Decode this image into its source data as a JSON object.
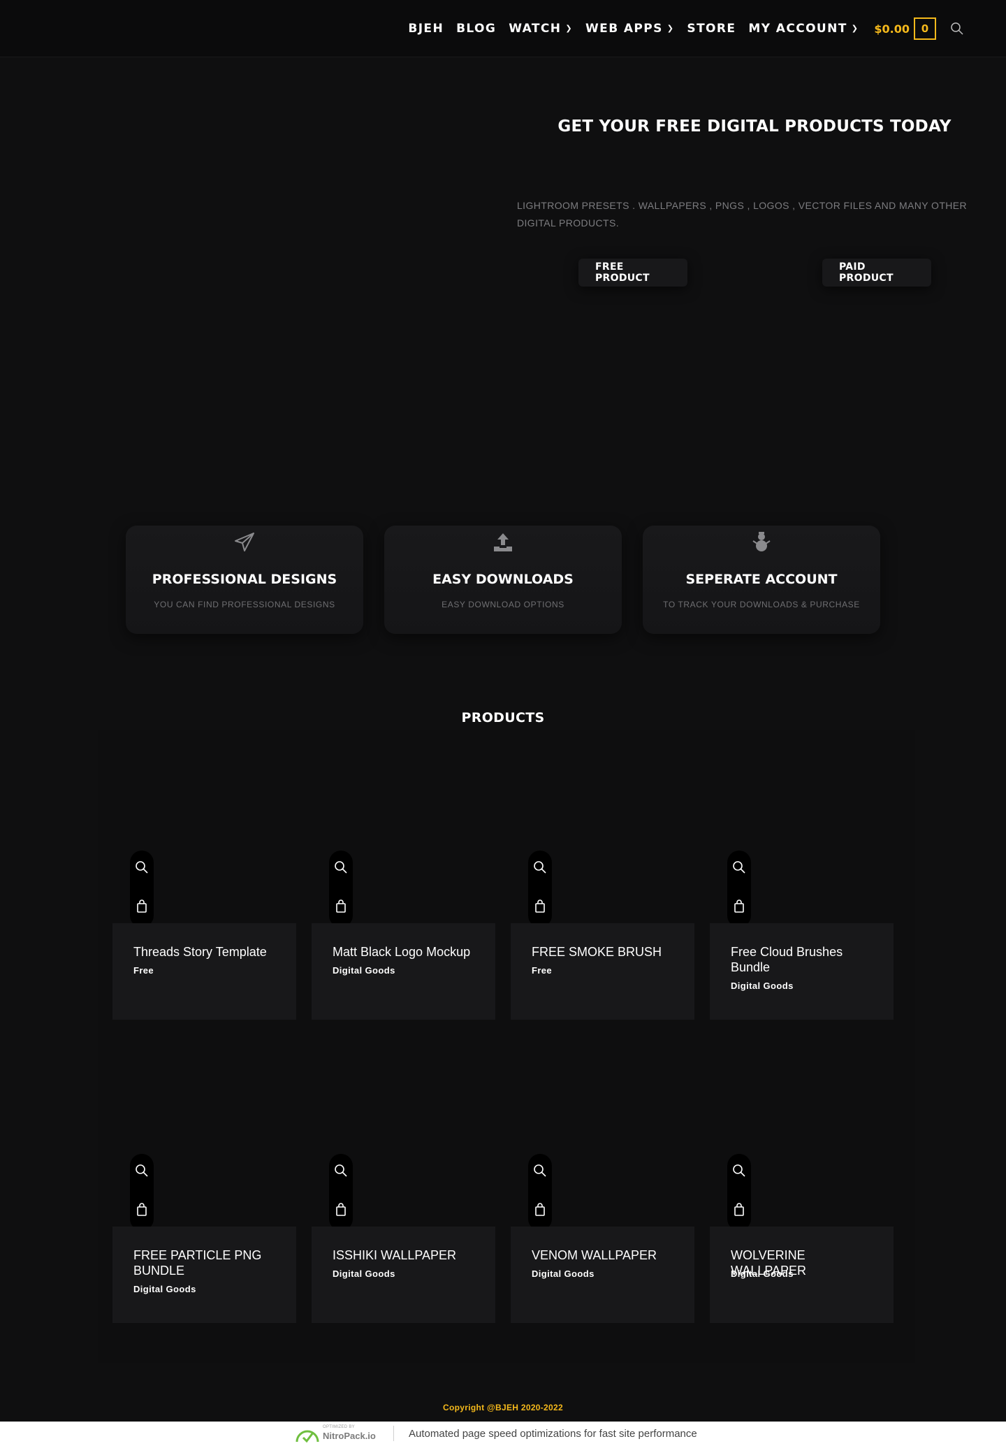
{
  "header": {
    "nav": [
      {
        "label": "BJEH",
        "has_dropdown": false
      },
      {
        "label": "BLOG",
        "has_dropdown": false
      },
      {
        "label": "WATCH",
        "has_dropdown": true
      },
      {
        "label": "WEB APPS",
        "has_dropdown": true
      },
      {
        "label": "STORE",
        "has_dropdown": false
      },
      {
        "label": "MY ACCOUNT",
        "has_dropdown": true
      }
    ],
    "cart_total": "$0.00",
    "cart_count": "0",
    "search_icon": "search-icon"
  },
  "hero": {
    "title": "GET YOUR FREE DIGITAL PRODUCTS TODAY",
    "description": "LIGHTROOM PRESETS . WALLPAPERS , PNGS , LOGOS , VECTOR FILES AND MANY OTHER DIGITAL PRODUCTS.",
    "buttons": {
      "free": "FREE PRODUCT",
      "paid": "PAID PRODUCT"
    }
  },
  "features": [
    {
      "icon": "paper-plane-icon",
      "title": "PROFESSIONAL DESIGNS",
      "subtitle": "YOU CAN FIND PROFESSIONAL DESIGNS"
    },
    {
      "icon": "upload-icon",
      "title": "EASY DOWNLOADS",
      "subtitle": "EASY DOWNLOAD OPTIONS"
    },
    {
      "icon": "snowman-icon",
      "title": "SEPERATE ACCOUNT",
      "subtitle": "TO TRACK YOUR DOWNLOADS & PURCHASE"
    }
  ],
  "products": {
    "title": "PRODUCTS",
    "items": [
      {
        "name": "Threads Story Template",
        "category": "Free"
      },
      {
        "name": "Matt Black Logo Mockup",
        "category": "Digital Goods"
      },
      {
        "name": "FREE SMOKE BRUSH",
        "category": "Free"
      },
      {
        "name": "Free Cloud Brushes Bundle",
        "category": "Digital Goods"
      },
      {
        "name": "FREE PARTICLE PNG BUNDLE",
        "category": "Digital Goods"
      },
      {
        "name": "ISSHIKI WALLPAPER",
        "category": "Digital Goods"
      },
      {
        "name": "VENOM WALLPAPER",
        "category": "Digital Goods"
      },
      {
        "name": "WOLVERINE WALLPAPER",
        "category": "Digital Goods"
      }
    ],
    "action_icons": [
      "search-icon",
      "shopping-bag-icon"
    ]
  },
  "footer": {
    "copyright": "Copyright @BJEH 2020-2022",
    "nitro": {
      "optimized_by": "OPTIMIZED BY",
      "brand": "NitroPack.io",
      "text": "Automated page speed optimizations for fast site performance"
    }
  },
  "colors": {
    "background": "#0f0f10",
    "accent": "#f5b91b",
    "card": "#18181a"
  }
}
